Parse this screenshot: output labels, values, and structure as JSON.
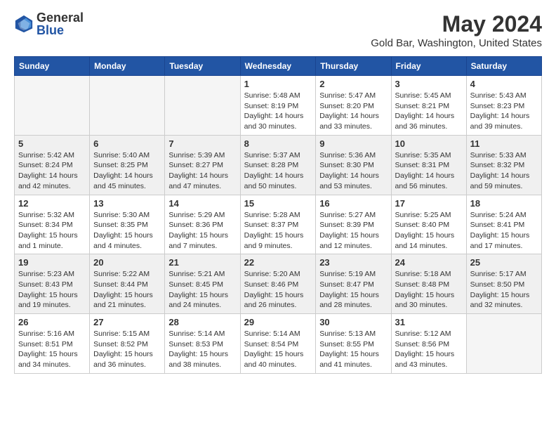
{
  "header": {
    "logo_general": "General",
    "logo_blue": "Blue",
    "month_title": "May 2024",
    "location": "Gold Bar, Washington, United States"
  },
  "weekdays": [
    "Sunday",
    "Monday",
    "Tuesday",
    "Wednesday",
    "Thursday",
    "Friday",
    "Saturday"
  ],
  "weeks": [
    [
      {
        "day": "",
        "info": ""
      },
      {
        "day": "",
        "info": ""
      },
      {
        "day": "",
        "info": ""
      },
      {
        "day": "1",
        "info": "Sunrise: 5:48 AM\nSunset: 8:19 PM\nDaylight: 14 hours\nand 30 minutes."
      },
      {
        "day": "2",
        "info": "Sunrise: 5:47 AM\nSunset: 8:20 PM\nDaylight: 14 hours\nand 33 minutes."
      },
      {
        "day": "3",
        "info": "Sunrise: 5:45 AM\nSunset: 8:21 PM\nDaylight: 14 hours\nand 36 minutes."
      },
      {
        "day": "4",
        "info": "Sunrise: 5:43 AM\nSunset: 8:23 PM\nDaylight: 14 hours\nand 39 minutes."
      }
    ],
    [
      {
        "day": "5",
        "info": "Sunrise: 5:42 AM\nSunset: 8:24 PM\nDaylight: 14 hours\nand 42 minutes."
      },
      {
        "day": "6",
        "info": "Sunrise: 5:40 AM\nSunset: 8:25 PM\nDaylight: 14 hours\nand 45 minutes."
      },
      {
        "day": "7",
        "info": "Sunrise: 5:39 AM\nSunset: 8:27 PM\nDaylight: 14 hours\nand 47 minutes."
      },
      {
        "day": "8",
        "info": "Sunrise: 5:37 AM\nSunset: 8:28 PM\nDaylight: 14 hours\nand 50 minutes."
      },
      {
        "day": "9",
        "info": "Sunrise: 5:36 AM\nSunset: 8:30 PM\nDaylight: 14 hours\nand 53 minutes."
      },
      {
        "day": "10",
        "info": "Sunrise: 5:35 AM\nSunset: 8:31 PM\nDaylight: 14 hours\nand 56 minutes."
      },
      {
        "day": "11",
        "info": "Sunrise: 5:33 AM\nSunset: 8:32 PM\nDaylight: 14 hours\nand 59 minutes."
      }
    ],
    [
      {
        "day": "12",
        "info": "Sunrise: 5:32 AM\nSunset: 8:34 PM\nDaylight: 15 hours\nand 1 minute."
      },
      {
        "day": "13",
        "info": "Sunrise: 5:30 AM\nSunset: 8:35 PM\nDaylight: 15 hours\nand 4 minutes."
      },
      {
        "day": "14",
        "info": "Sunrise: 5:29 AM\nSunset: 8:36 PM\nDaylight: 15 hours\nand 7 minutes."
      },
      {
        "day": "15",
        "info": "Sunrise: 5:28 AM\nSunset: 8:37 PM\nDaylight: 15 hours\nand 9 minutes."
      },
      {
        "day": "16",
        "info": "Sunrise: 5:27 AM\nSunset: 8:39 PM\nDaylight: 15 hours\nand 12 minutes."
      },
      {
        "day": "17",
        "info": "Sunrise: 5:25 AM\nSunset: 8:40 PM\nDaylight: 15 hours\nand 14 minutes."
      },
      {
        "day": "18",
        "info": "Sunrise: 5:24 AM\nSunset: 8:41 PM\nDaylight: 15 hours\nand 17 minutes."
      }
    ],
    [
      {
        "day": "19",
        "info": "Sunrise: 5:23 AM\nSunset: 8:43 PM\nDaylight: 15 hours\nand 19 minutes."
      },
      {
        "day": "20",
        "info": "Sunrise: 5:22 AM\nSunset: 8:44 PM\nDaylight: 15 hours\nand 21 minutes."
      },
      {
        "day": "21",
        "info": "Sunrise: 5:21 AM\nSunset: 8:45 PM\nDaylight: 15 hours\nand 24 minutes."
      },
      {
        "day": "22",
        "info": "Sunrise: 5:20 AM\nSunset: 8:46 PM\nDaylight: 15 hours\nand 26 minutes."
      },
      {
        "day": "23",
        "info": "Sunrise: 5:19 AM\nSunset: 8:47 PM\nDaylight: 15 hours\nand 28 minutes."
      },
      {
        "day": "24",
        "info": "Sunrise: 5:18 AM\nSunset: 8:48 PM\nDaylight: 15 hours\nand 30 minutes."
      },
      {
        "day": "25",
        "info": "Sunrise: 5:17 AM\nSunset: 8:50 PM\nDaylight: 15 hours\nand 32 minutes."
      }
    ],
    [
      {
        "day": "26",
        "info": "Sunrise: 5:16 AM\nSunset: 8:51 PM\nDaylight: 15 hours\nand 34 minutes."
      },
      {
        "day": "27",
        "info": "Sunrise: 5:15 AM\nSunset: 8:52 PM\nDaylight: 15 hours\nand 36 minutes."
      },
      {
        "day": "28",
        "info": "Sunrise: 5:14 AM\nSunset: 8:53 PM\nDaylight: 15 hours\nand 38 minutes."
      },
      {
        "day": "29",
        "info": "Sunrise: 5:14 AM\nSunset: 8:54 PM\nDaylight: 15 hours\nand 40 minutes."
      },
      {
        "day": "30",
        "info": "Sunrise: 5:13 AM\nSunset: 8:55 PM\nDaylight: 15 hours\nand 41 minutes."
      },
      {
        "day": "31",
        "info": "Sunrise: 5:12 AM\nSunset: 8:56 PM\nDaylight: 15 hours\nand 43 minutes."
      },
      {
        "day": "",
        "info": ""
      }
    ]
  ]
}
